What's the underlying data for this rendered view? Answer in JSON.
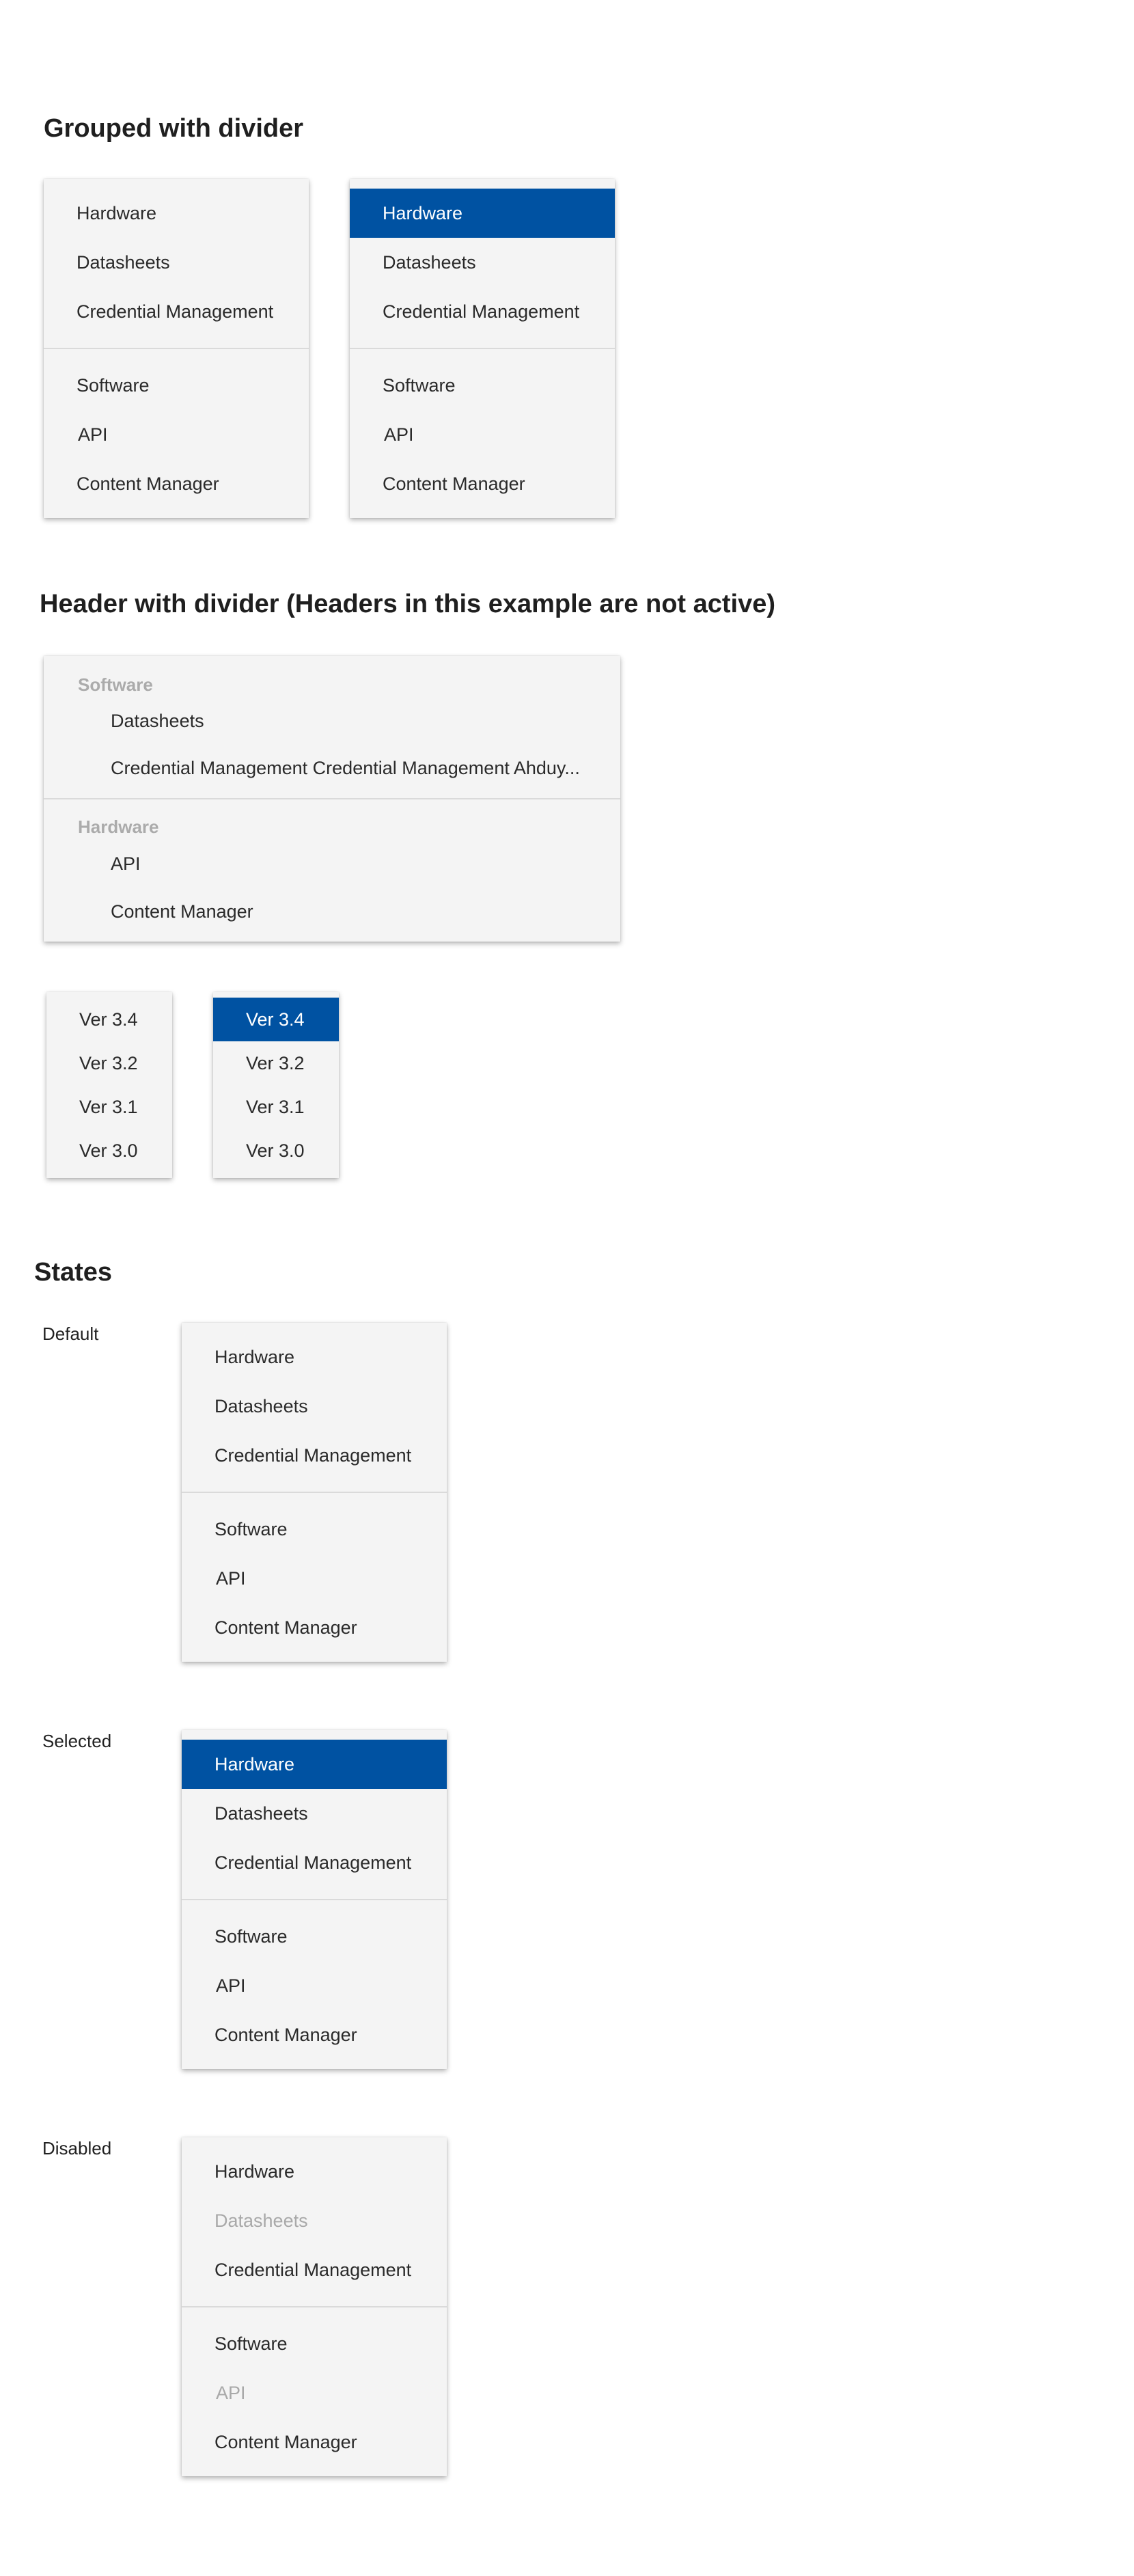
{
  "sections": {
    "grouped_title": "Grouped with divider",
    "header_title": "Header with divider (Headers in this example are not active)",
    "states_title": "States"
  },
  "grouped_menu": {
    "group1": [
      "Hardware",
      "Datasheets",
      "Credential Management"
    ],
    "group2": [
      "Software",
      "API",
      "Content Manager"
    ]
  },
  "header_menu": {
    "groups": [
      {
        "header": "Software",
        "items": [
          "Datasheets",
          "Credential Management Credential Management Ahduy..."
        ]
      },
      {
        "header": "Hardware",
        "items": [
          "API",
          "Content Manager"
        ]
      }
    ]
  },
  "version_menu": {
    "items": [
      "Ver 3.4",
      "Ver 3.2",
      "Ver 3.1",
      "Ver 3.0"
    ]
  },
  "states": {
    "default_label": "Default",
    "selected_label": "Selected",
    "disabled_label": "Disabled"
  },
  "colors": {
    "selected_bg": "#0052a2",
    "menu_bg": "#f4f4f4",
    "disabled_text": "#a9a9a9",
    "header_text": "#ababab"
  }
}
